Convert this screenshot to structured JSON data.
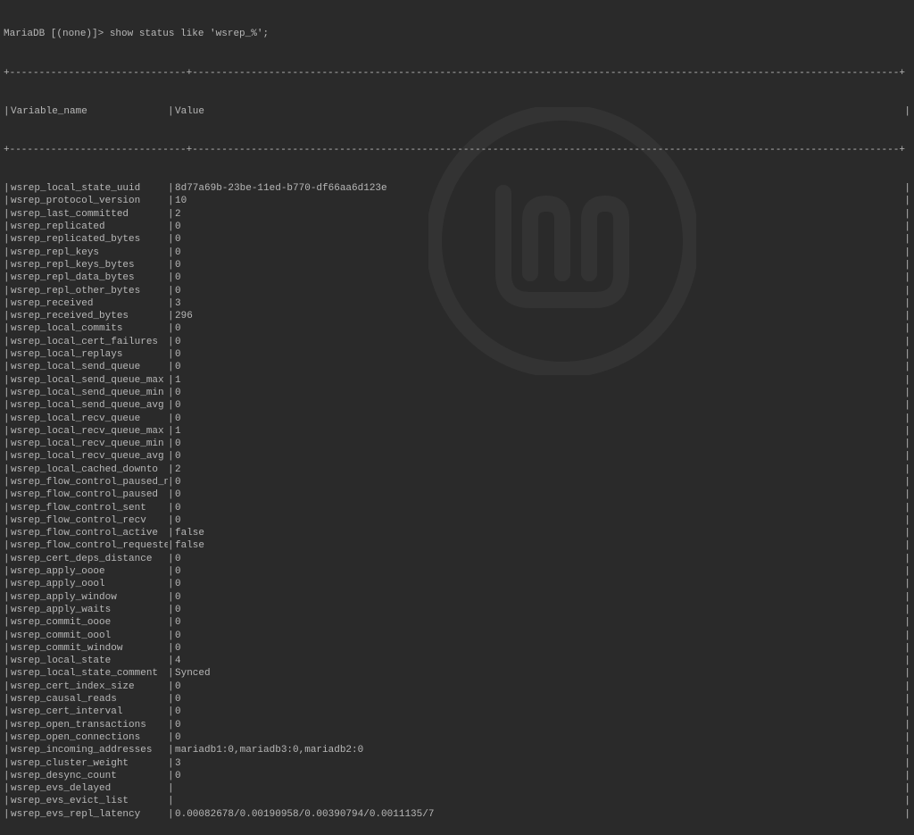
{
  "prompt": "MariaDB [(none)]> show status like 'wsrep_%';",
  "header": {
    "variable_name": "Variable_name",
    "value": "Value"
  },
  "rows": [
    {
      "name": "wsrep_local_state_uuid",
      "value": "8d77a69b-23be-11ed-b770-df66aa6d123e"
    },
    {
      "name": "wsrep_protocol_version",
      "value": "10"
    },
    {
      "name": "wsrep_last_committed",
      "value": "2"
    },
    {
      "name": "wsrep_replicated",
      "value": "0"
    },
    {
      "name": "wsrep_replicated_bytes",
      "value": "0"
    },
    {
      "name": "wsrep_repl_keys",
      "value": "0"
    },
    {
      "name": "wsrep_repl_keys_bytes",
      "value": "0"
    },
    {
      "name": "wsrep_repl_data_bytes",
      "value": "0"
    },
    {
      "name": "wsrep_repl_other_bytes",
      "value": "0"
    },
    {
      "name": "wsrep_received",
      "value": "3"
    },
    {
      "name": "wsrep_received_bytes",
      "value": "296"
    },
    {
      "name": "wsrep_local_commits",
      "value": "0"
    },
    {
      "name": "wsrep_local_cert_failures",
      "value": "0"
    },
    {
      "name": "wsrep_local_replays",
      "value": "0"
    },
    {
      "name": "wsrep_local_send_queue",
      "value": "0"
    },
    {
      "name": "wsrep_local_send_queue_max",
      "value": "1"
    },
    {
      "name": "wsrep_local_send_queue_min",
      "value": "0"
    },
    {
      "name": "wsrep_local_send_queue_avg",
      "value": "0"
    },
    {
      "name": "wsrep_local_recv_queue",
      "value": "0"
    },
    {
      "name": "wsrep_local_recv_queue_max",
      "value": "1"
    },
    {
      "name": "wsrep_local_recv_queue_min",
      "value": "0"
    },
    {
      "name": "wsrep_local_recv_queue_avg",
      "value": "0"
    },
    {
      "name": "wsrep_local_cached_downto",
      "value": "2"
    },
    {
      "name": "wsrep_flow_control_paused_ns",
      "value": "0"
    },
    {
      "name": "wsrep_flow_control_paused",
      "value": "0"
    },
    {
      "name": "wsrep_flow_control_sent",
      "value": "0"
    },
    {
      "name": "wsrep_flow_control_recv",
      "value": "0"
    },
    {
      "name": "wsrep_flow_control_active",
      "value": "false"
    },
    {
      "name": "wsrep_flow_control_requested",
      "value": "false"
    },
    {
      "name": "wsrep_cert_deps_distance",
      "value": "0"
    },
    {
      "name": "wsrep_apply_oooe",
      "value": "0"
    },
    {
      "name": "wsrep_apply_oool",
      "value": "0"
    },
    {
      "name": "wsrep_apply_window",
      "value": "0"
    },
    {
      "name": "wsrep_apply_waits",
      "value": "0"
    },
    {
      "name": "wsrep_commit_oooe",
      "value": "0"
    },
    {
      "name": "wsrep_commit_oool",
      "value": "0"
    },
    {
      "name": "wsrep_commit_window",
      "value": "0"
    },
    {
      "name": "wsrep_local_state",
      "value": "4"
    },
    {
      "name": "wsrep_local_state_comment",
      "value": "Synced"
    },
    {
      "name": "wsrep_cert_index_size",
      "value": "0"
    },
    {
      "name": "wsrep_causal_reads",
      "value": "0"
    },
    {
      "name": "wsrep_cert_interval",
      "value": "0"
    },
    {
      "name": "wsrep_open_transactions",
      "value": "0"
    },
    {
      "name": "wsrep_open_connections",
      "value": "0"
    },
    {
      "name": "wsrep_incoming_addresses",
      "value": "mariadb1:0,mariadb3:0,mariadb2:0"
    },
    {
      "name": "wsrep_cluster_weight",
      "value": "3"
    },
    {
      "name": "wsrep_desync_count",
      "value": "0"
    },
    {
      "name": "wsrep_evs_delayed",
      "value": ""
    },
    {
      "name": "wsrep_evs_evict_list",
      "value": ""
    },
    {
      "name": "wsrep_evs_repl_latency",
      "value": "0.00082678/0.00190958/0.00390794/0.0011135/7"
    }
  ]
}
